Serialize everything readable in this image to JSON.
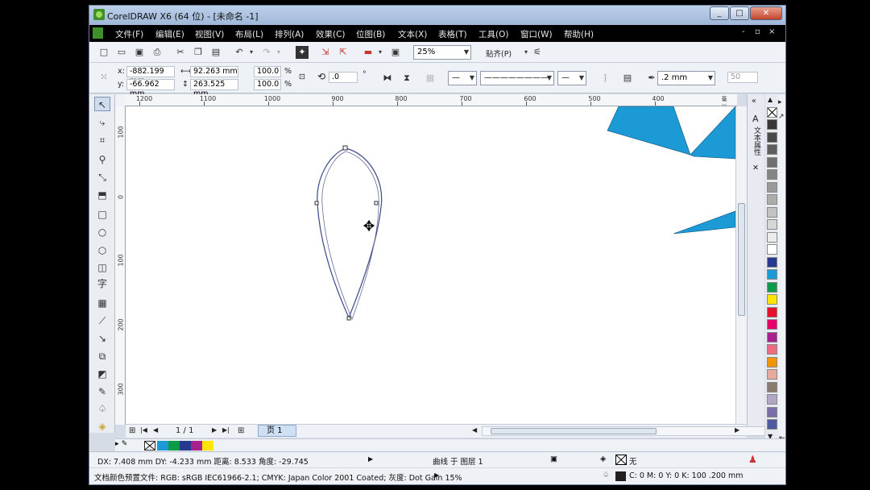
{
  "window": {
    "title": "CorelDRAW X6 (64 位) - [未命名 -1]",
    "controls": [
      "_",
      "□",
      "✕"
    ]
  },
  "menu": {
    "items": [
      "文件(F)",
      "编辑(E)",
      "视图(V)",
      "布局(L)",
      "排列(A)",
      "效果(C)",
      "位图(B)",
      "文本(X)",
      "表格(T)",
      "工具(O)",
      "窗口(W)",
      "帮助(H)"
    ],
    "doc_controls": [
      "-",
      "▫",
      "×"
    ]
  },
  "toolbar": {
    "zoom": "25%",
    "snap_label": "贴齐(P)"
  },
  "property_bar": {
    "x_label": "x:",
    "x_value": "-882.199 mm",
    "y_label": "y:",
    "y_value": "-66.962 mm",
    "width_value": "92.263 mm",
    "height_value": "263.525 mm",
    "scale_x": "100.0",
    "scale_y": "100.0",
    "percent": "%",
    "rotation": ".0",
    "degree": "°",
    "outline_width": ".2 mm",
    "miter": "50"
  },
  "rulers": {
    "horizontal": [
      "1200",
      "1100",
      "1000",
      "900",
      "800",
      "700",
      "600",
      "500",
      "400"
    ],
    "h_unit": "毫米",
    "vertical": [
      "100",
      "0",
      "100",
      "200",
      "300"
    ]
  },
  "docker": {
    "tab_label": "文本属性"
  },
  "page_nav": {
    "page_count": "1 / 1",
    "page_tab": "页 1"
  },
  "status": {
    "line1_left": "DX: 7.408 mm DY: -4.233 mm 距离: 8.533 角度: -29.745",
    "line1_mid": "曲线 于 图层 1",
    "fill_label": "无",
    "line2_left": "文档颜色预置文件: RGB: sRGB IEC61966-2.1; CMYK: Japan Color 2001 Coated; 灰度: Dot Gain 15%",
    "outline_info": "C: 0 M: 0 Y: 0 K: 100  .200 mm"
  },
  "colors": {
    "shape_fill": "#1b9ad6",
    "palette": [
      "#3a3536",
      "#4a4a4a",
      "#5e5e5e",
      "#707070",
      "#858585",
      "#999999",
      "#adadad",
      "#c2c2c2",
      "#d6d6d6",
      "#ebebeb",
      "#ffffff",
      "#283a8f",
      "#1b9ad6",
      "#0e9a48",
      "#ffe600",
      "#e6102a",
      "#e5006b",
      "#a7228d",
      "#ec6c7f",
      "#f29600",
      "#e7a99a",
      "#8c7a6e",
      "#b3a7c7",
      "#7a6fa8",
      "#4d5aa0"
    ],
    "doc_palette": [
      "#1b9ad6",
      "#0e9a48",
      "#283a8f",
      "#a7228d",
      "#ffe600"
    ]
  }
}
